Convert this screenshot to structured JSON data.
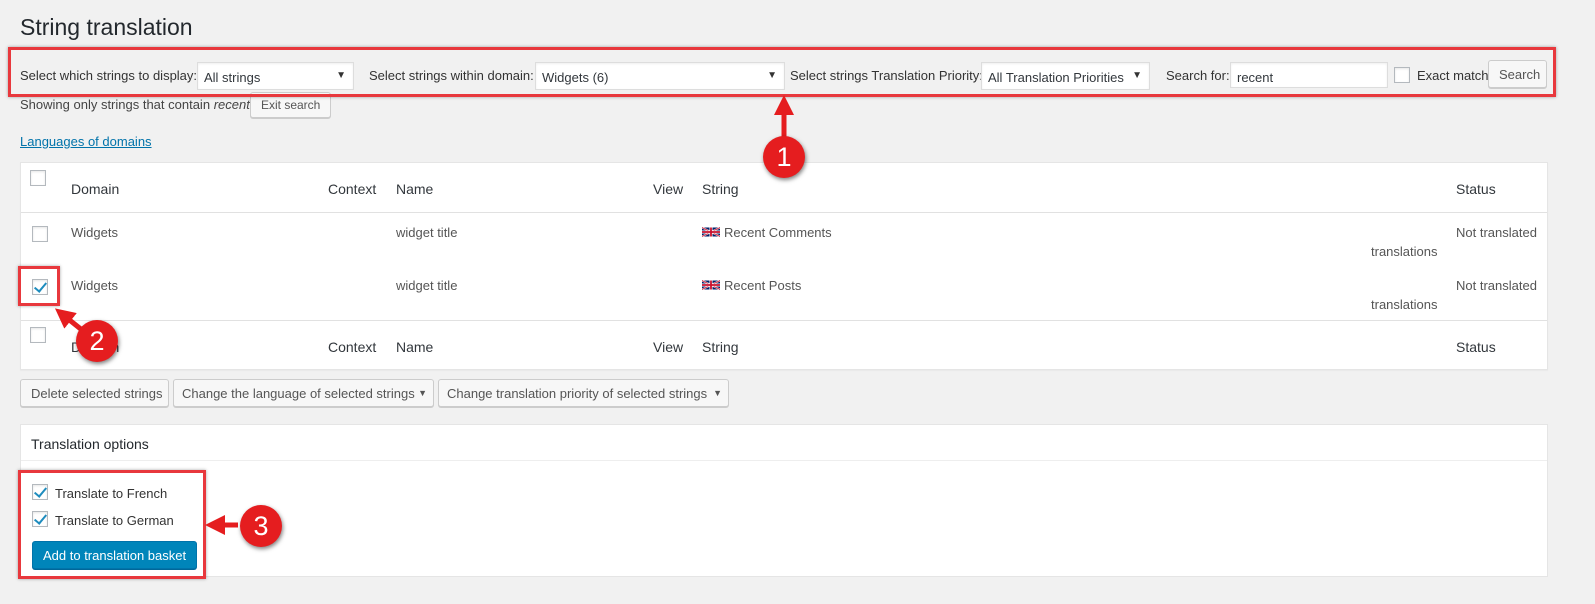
{
  "page": {
    "title": "String translation"
  },
  "filters": {
    "display_label": "Select which strings to display:",
    "display_value": "All strings",
    "domain_label": "Select strings within domain:",
    "domain_value": "Widgets (6)",
    "priority_label": "Select strings Translation Priority:",
    "priority_value": "All Translation Priorities",
    "search_label": "Search for:",
    "search_value": "recent",
    "exact_match_label": "Exact match",
    "search_button": "Search"
  },
  "search_notice": {
    "prefix": "Showing only strings that contain",
    "term": "recent",
    "exit_button": "Exit search"
  },
  "languages_link": "Languages of domains",
  "table": {
    "headers": {
      "domain": "Domain",
      "context": "Context",
      "name": "Name",
      "view": "View",
      "string": "String",
      "status": "Status"
    },
    "rows": [
      {
        "domain": "Widgets",
        "name": "widget title",
        "string": "Recent Comments",
        "translations_link": "translations",
        "status": "Not translated",
        "checked": false
      },
      {
        "domain": "Widgets",
        "name": "widget title",
        "string": "Recent Posts",
        "translations_link": "translations",
        "status": "Not translated",
        "checked": true
      }
    ]
  },
  "bulk_actions": {
    "delete": "Delete selected strings",
    "change_language": "Change the language of selected strings",
    "change_priority": "Change translation priority of selected strings"
  },
  "translation_options": {
    "heading": "Translation options",
    "french": "Translate to French",
    "german": "Translate to German",
    "add_button": "Add to translation basket"
  },
  "annotations": {
    "one": "1",
    "two": "2",
    "three": "3"
  },
  "colors": {
    "annotation_red": "#e51d1f",
    "primary_blue": "#0085ba",
    "link_blue": "#0073aa"
  }
}
